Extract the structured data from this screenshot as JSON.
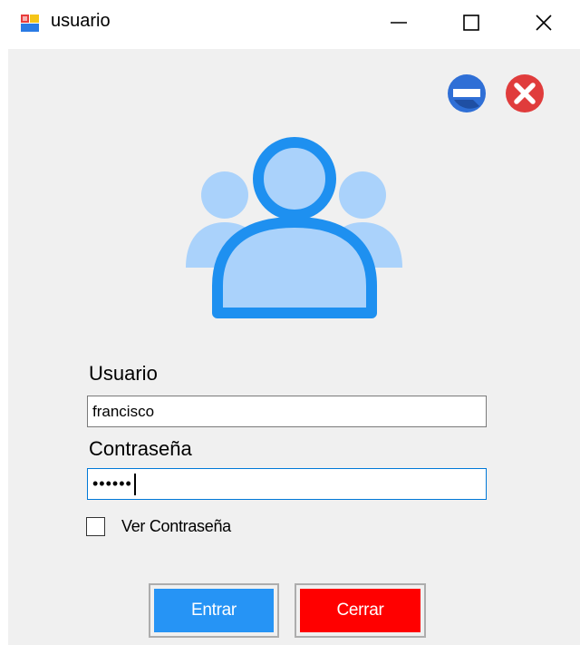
{
  "window": {
    "title": "usuario",
    "icons": {
      "app": "app-icon",
      "minimize": "minimize-icon",
      "maximize": "maximize-icon",
      "close": "close-icon"
    }
  },
  "header_actions": {
    "minimize_icon": "minimize-circle-icon",
    "close_icon": "close-circle-icon",
    "minimize_color": "#2f6fd6",
    "close_color": "#e03c3c"
  },
  "graphic": {
    "icon": "users-group-icon",
    "primary_color": "#1e90f0",
    "light_color": "#aad2fb"
  },
  "form": {
    "username_label": "Usuario",
    "username_value": "francisco",
    "password_label": "Contraseña",
    "password_value": "••••••",
    "show_password_label": "Ver Contraseña",
    "show_password_checked": false
  },
  "buttons": {
    "enter_label": "Entrar",
    "close_label": "Cerrar",
    "enter_color": "#2694f5",
    "close_color": "#ff0000"
  }
}
